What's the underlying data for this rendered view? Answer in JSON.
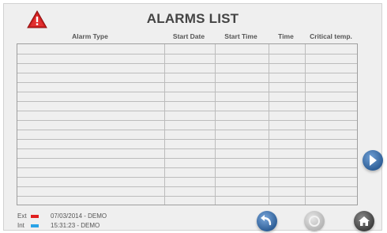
{
  "header": {
    "title": "ALARMS LIST"
  },
  "table": {
    "columns": [
      "Alarm Type",
      "Start Date",
      "Start Time",
      "Time",
      "Critical temp."
    ],
    "rows": []
  },
  "legend": [
    {
      "label": "Ext",
      "color": "#e02020",
      "value": "07/03/2014 - DEMO"
    },
    {
      "label": "Int",
      "color": "#2aa3e6",
      "value": "15:31:23 - DEMO"
    }
  ],
  "colors": {
    "alarm_red": "#cc1f1f",
    "button_blue": "#3a6fa8",
    "button_grey": "#c4c4c4",
    "button_dark": "#505050"
  },
  "icons": {
    "alarm": "warning-triangle-icon",
    "next_page": "arrow-right-icon",
    "back": "back-arrow-icon",
    "disabled": "disabled-icon",
    "home": "home-icon"
  }
}
